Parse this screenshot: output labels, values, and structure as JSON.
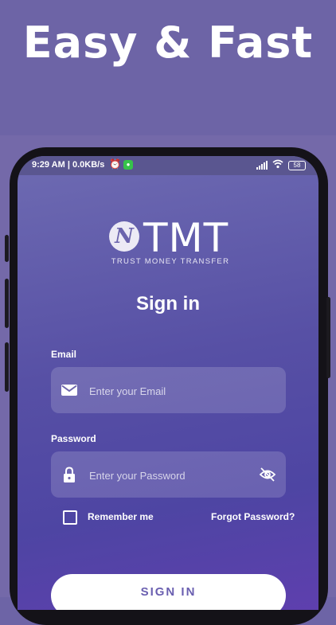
{
  "promo": {
    "headline": "Easy & Fast"
  },
  "status_bar": {
    "time": "9:29 AM | 0.0KB/s",
    "battery": "58",
    "icons": [
      "alarm-icon",
      "whatsapp-icon",
      "signal-icon",
      "wifi-icon",
      "battery-icon"
    ]
  },
  "logo": {
    "letter": "N",
    "name": "TMT",
    "tagline": "TRUST MONEY TRANSFER"
  },
  "form": {
    "title": "Sign in",
    "email": {
      "label": "Email",
      "placeholder": "Enter your Email",
      "value": "",
      "icon": "mail-icon"
    },
    "password": {
      "label": "Password",
      "placeholder": "Enter your Password",
      "value": "",
      "icon": "lock-icon",
      "toggle_icon": "eye-off-icon"
    },
    "remember_label": "Remember me",
    "remember_checked": false,
    "forgot_label": "Forgot Password?",
    "submit_label": "SIGN IN"
  },
  "colors": {
    "background": "#6d64a6",
    "button_text": "#6a5fb0",
    "status_app_badge": "#36c24a"
  }
}
